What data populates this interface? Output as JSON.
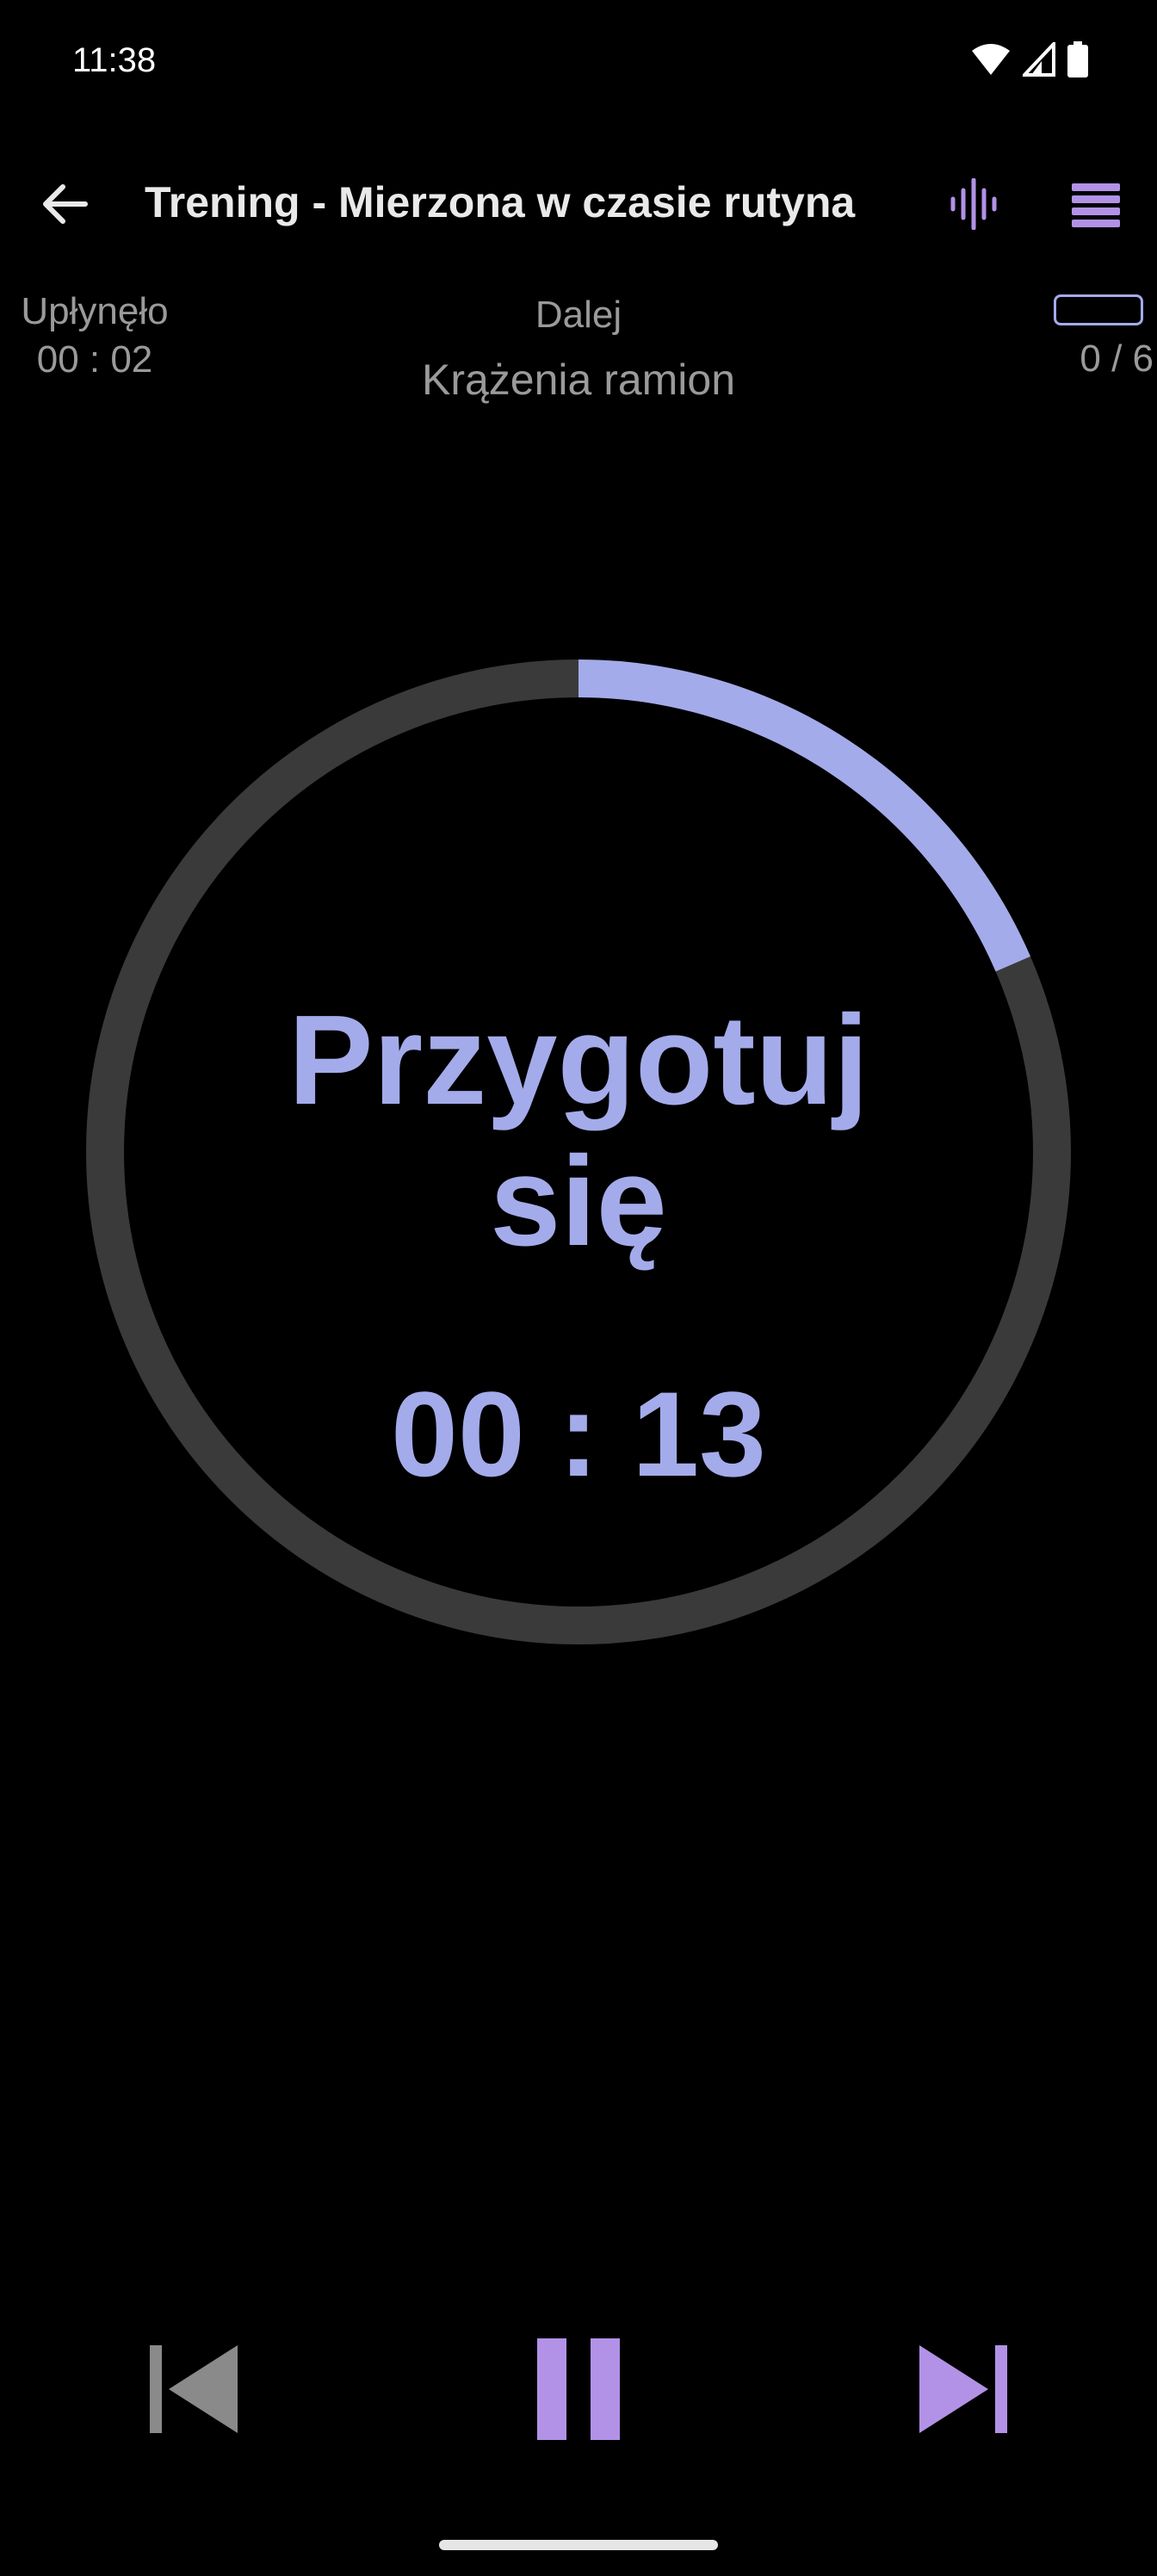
{
  "status_bar": {
    "time": "11:38",
    "icons": [
      "wifi-icon",
      "signal-icon",
      "battery-icon"
    ]
  },
  "app_bar": {
    "title": "Trening - Mierzona w czasie rutyna",
    "back_icon": "arrow-left-icon",
    "sound_icon": "waveform-icon",
    "menu_icon": "list-icon"
  },
  "info": {
    "elapsed_label": "Upłynęło",
    "elapsed_value": "00 : 02",
    "next_label": "Dalej",
    "next_value": "Krążenia ramion",
    "counter": "0 / 6",
    "overall_progress": 0
  },
  "timer": {
    "phase_line1": "Przygotuj",
    "phase_line2": "się",
    "remaining": "00 : 13",
    "progress_fraction": 0.185
  },
  "controls": {
    "prev_icon": "skip-previous-icon",
    "pause_icon": "pause-icon",
    "next_icon": "skip-next-icon"
  },
  "colors": {
    "accent": "#a4abea",
    "accent_purple": "#b292e6",
    "track": "#3a3a3a",
    "muted_text": "#9a9a9a",
    "disabled_icon": "#8a8a8a"
  }
}
